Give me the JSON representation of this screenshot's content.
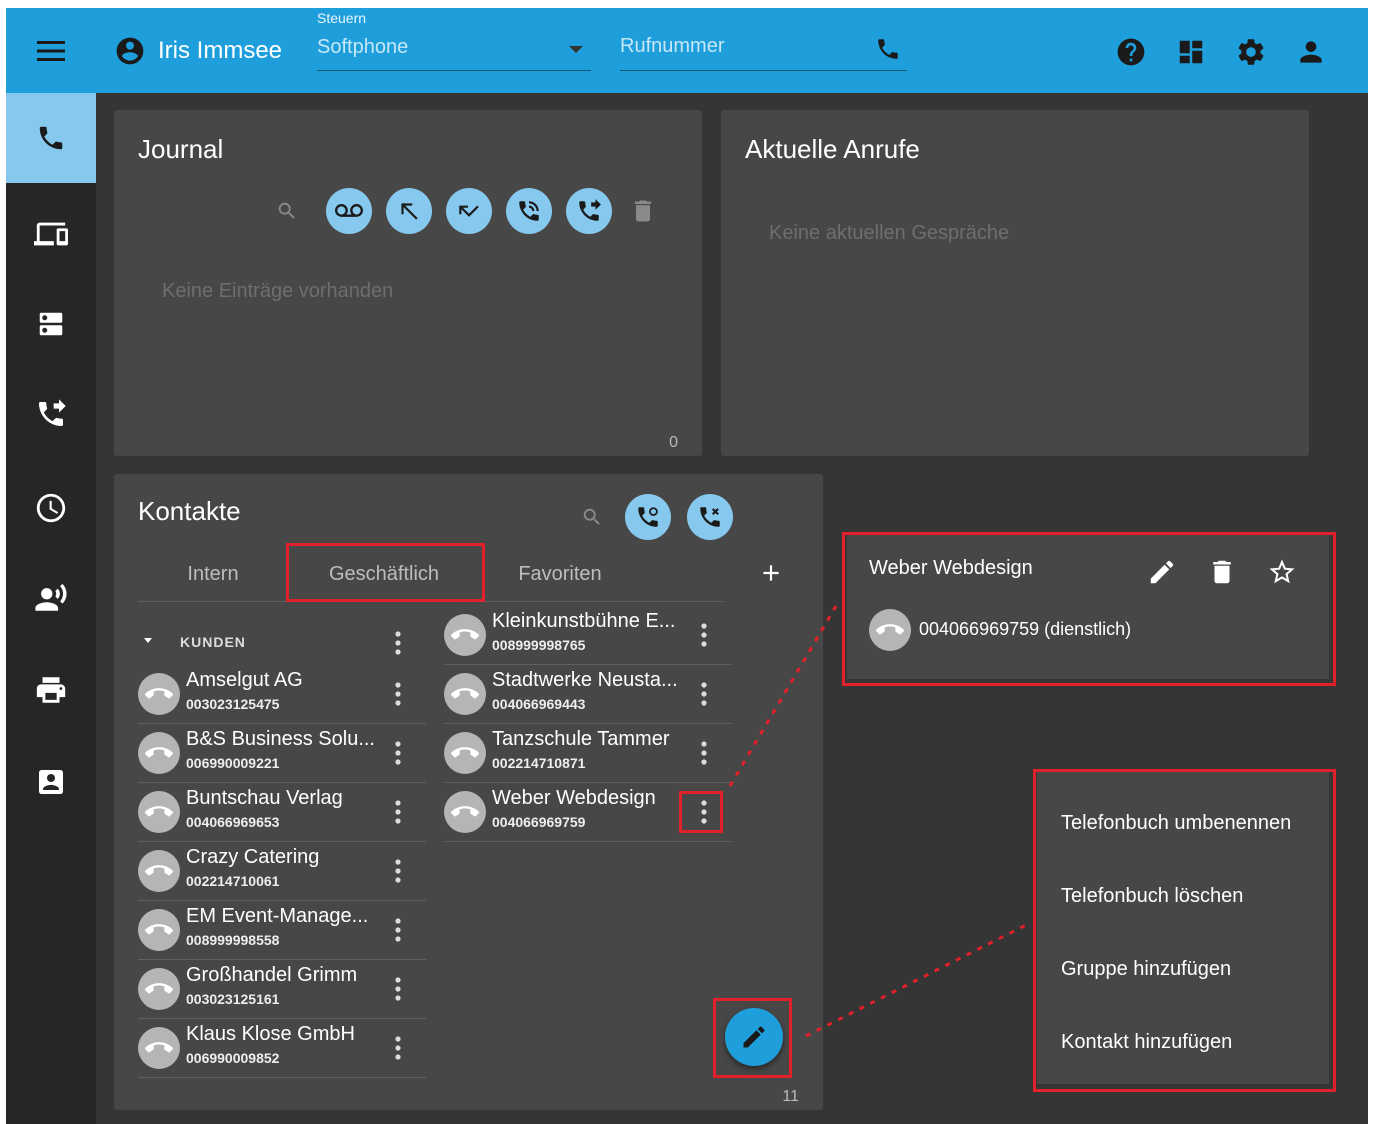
{
  "topbar": {
    "user_name": "Iris Immsee",
    "control_label": "Steuern",
    "control_value": "Softphone",
    "phone_placeholder": "Rufnummer"
  },
  "journal": {
    "title": "Journal",
    "empty_text": "Keine Einträge vorhanden",
    "count": "0"
  },
  "current_calls": {
    "title": "Aktuelle Anrufe",
    "empty_text": "Keine aktuellen Gespräche"
  },
  "contacts": {
    "title": "Kontakte",
    "tabs": [
      "Intern",
      "Geschäftlich",
      "Favoriten"
    ],
    "group_name": "KUNDEN",
    "left_column": [
      {
        "name": "Amselgut AG",
        "number": "003023125475"
      },
      {
        "name": "B&S Business Solu...",
        "number": "006990009221"
      },
      {
        "name": "Buntschau Verlag",
        "number": "004066969653"
      },
      {
        "name": "Crazy Catering",
        "number": "002214710061"
      },
      {
        "name": "EM Event-Manage...",
        "number": "008999998558"
      },
      {
        "name": "Großhandel Grimm",
        "number": "003023125161"
      },
      {
        "name": "Klaus Klose GmbH",
        "number": "006990009852"
      }
    ],
    "right_column": [
      {
        "name": "Kleinkunstbühne E...",
        "number": "008999998765"
      },
      {
        "name": "Stadtwerke Neusta...",
        "number": "004066969443"
      },
      {
        "name": "Tanzschule Tammer",
        "number": "002214710871"
      },
      {
        "name": "Weber Webdesign",
        "number": "004066969759"
      }
    ],
    "count": "11"
  },
  "detail": {
    "name": "Weber Webdesign",
    "number": "004066969759 (dienstlich)"
  },
  "menu": {
    "items": [
      "Telefonbuch umbenennen",
      "Telefonbuch löschen",
      "Gruppe hinzufügen",
      "Kontakt hinzufügen"
    ]
  },
  "colors": {
    "accent": "#1e9fdc",
    "accent_light": "#87c9ee",
    "background": "#353535",
    "panel": "#474747",
    "highlight": "#e0202a"
  }
}
